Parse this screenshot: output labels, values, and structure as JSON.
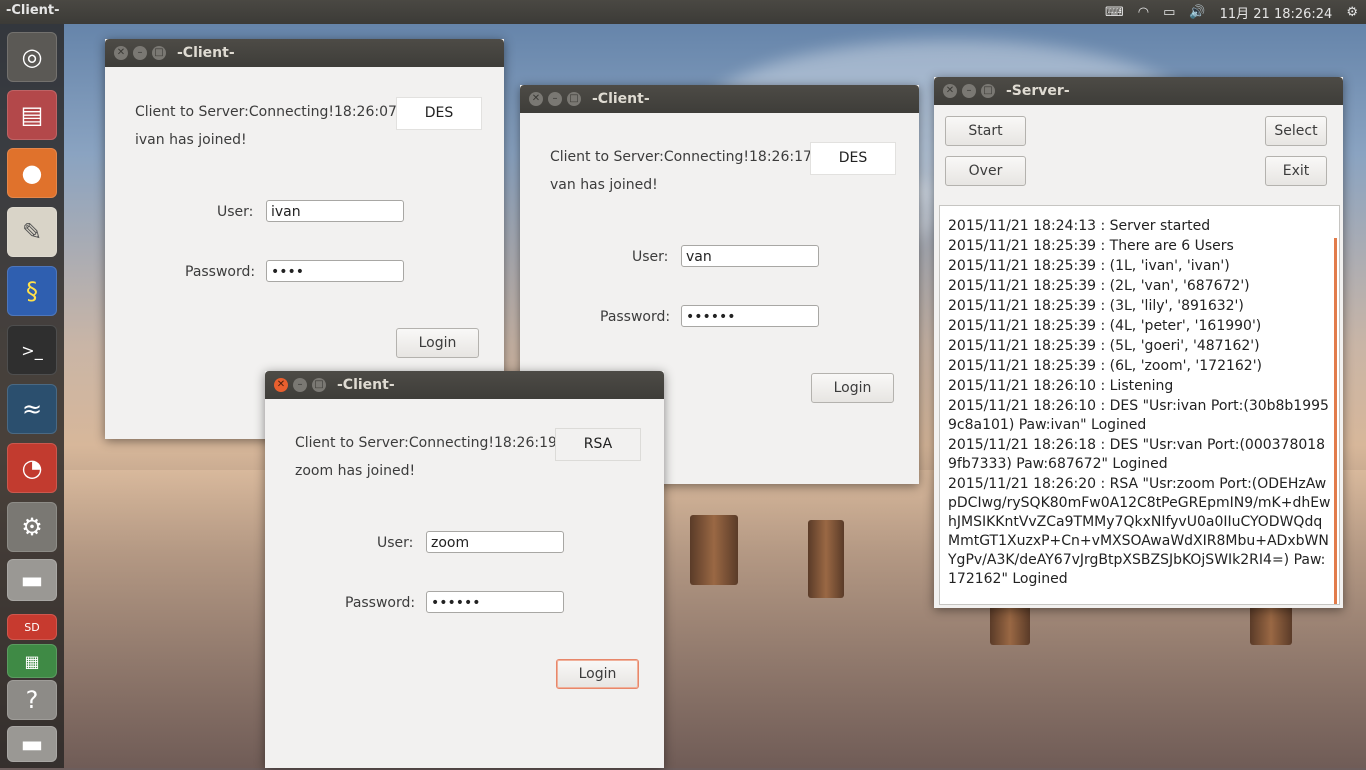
{
  "topbar": {
    "app_title": "-Client-",
    "keyboard_icon": "keyboard-icon",
    "wifi_icon": "wifi-icon",
    "battery_icon": "battery-icon",
    "volume_icon": "volume-icon",
    "datetime": "11月 21 18:26:24",
    "settings_icon": "gear-icon"
  },
  "launcher": {
    "items": [
      "ubuntu-dash-icon",
      "file-manager-icon",
      "firefox-icon",
      "text-editor-icon",
      "python-idle-icon",
      "terminal-icon",
      "mysql-workbench-icon",
      "chart-app-icon",
      "system-settings-icon",
      "disk-drive-icon",
      "sd-card-icon",
      "spreadsheet-icon",
      "help-icon",
      "removable-drive-icon"
    ],
    "sd_label": "SD"
  },
  "client1": {
    "title": "-Client-",
    "status": "Client to Server:Connecting!18:26:07",
    "joined": "ivan has joined!",
    "cipher": "DES",
    "user_label": "User:",
    "user_value": "ivan",
    "password_label": "Password:",
    "password_value": "••••",
    "login_label": "Login"
  },
  "client2": {
    "title": "-Client-",
    "status": "Client to Server:Connecting!18:26:17",
    "joined": "van has joined!",
    "cipher": "DES",
    "user_label": "User:",
    "user_value": "van",
    "password_label": "Password:",
    "password_value": "••••••",
    "login_label": "Login"
  },
  "client3": {
    "title": "-Client-",
    "status": "Client to Server:Connecting!18:26:19",
    "joined": "zoom has joined!",
    "cipher": "RSA",
    "user_label": "User:",
    "user_value": "zoom",
    "password_label": "Password:",
    "password_value": "••••••",
    "login_label": "Login"
  },
  "server": {
    "title": "-Server-",
    "start_label": "Start",
    "select_label": "Select",
    "over_label": "Over",
    "exit_label": "Exit",
    "log": [
      "2015/11/21 18:24:13 : Server started",
      "2015/11/21 18:25:39 : There are 6 Users",
      "2015/11/21 18:25:39 : (1L, 'ivan', 'ivan')",
      "2015/11/21 18:25:39 : (2L, 'van', '687672')",
      "2015/11/21 18:25:39 : (3L, 'lily', '891632')",
      "2015/11/21 18:25:39 : (4L, 'peter', '161990')",
      "2015/11/21 18:25:39 : (5L, 'goeri', '487162')",
      "2015/11/21 18:25:39 : (6L, 'zoom', '172162')",
      "2015/11/21 18:26:10 : Listening",
      "2015/11/21 18:26:10 : DES \"Usr:ivan Port:(30b8b19959c8a101) Paw:ivan\" Logined",
      "2015/11/21 18:26:18 : DES \"Usr:van Port:(0003780189fb7333) Paw:687672\" Logined",
      "2015/11/21 18:26:20 : RSA \"Usr:zoom Port:(ODEHzAwpDCIwg/rySQK80mFw0A12C8tPeGREpmIN9/mK+dhEwhJMSIKKntVvZCa9TMMy7QkxNIfyvU0a0IIuCYODWQdqMmtGT1XuzxP+Cn+vMXSOAwaWdXIR8Mbu+ADxbWNYgPv/A3K/deAY67vJrgBtpXSBZSJbKOjSWIk2RI4=) Paw:172162\" Logined"
    ]
  }
}
